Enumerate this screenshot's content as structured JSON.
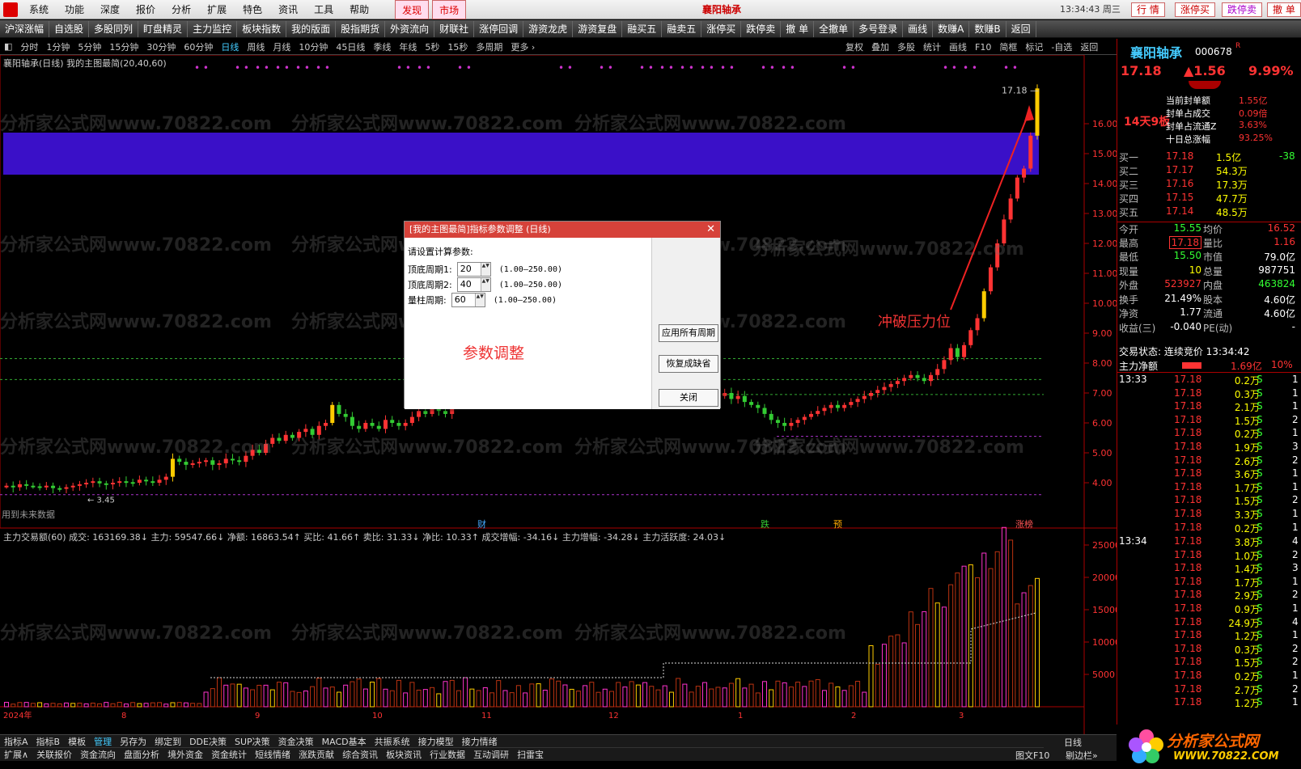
{
  "menu": {
    "items": [
      "系统",
      "功能",
      "深度",
      "报价",
      "分析",
      "扩展",
      "特色",
      "资讯",
      "工具",
      "帮助"
    ],
    "hot": [
      "发现",
      "市场"
    ],
    "title": "襄阳轴承",
    "time": "13:34:43 周三",
    "right_buttons": [
      "行 情",
      "涨停买",
      "跌停卖",
      "撤 单"
    ]
  },
  "toolbar": [
    "沪深涨幅",
    "自选股",
    "多股同列",
    "盯盘精灵",
    "主力监控",
    "板块指数",
    "我的版面",
    "股指期货",
    "外资流向",
    "财联社",
    "涨停回调",
    "游资龙虎",
    "游资复盘",
    "融买五",
    "融卖五",
    "涨停买",
    "跌停卖",
    "撤 单",
    "全撤单",
    "多号登录",
    "画线",
    "数赚A",
    "数赚B",
    "返回"
  ],
  "periods": [
    "分时",
    "1分钟",
    "5分钟",
    "15分钟",
    "30分钟",
    "60分钟",
    "日线",
    "周线",
    "月线",
    "10分钟",
    "45日线",
    "季线",
    "年线",
    "5秒",
    "15秒",
    "多周期",
    "更多 ›"
  ],
  "active_period": "日线",
  "toolright": [
    "复权",
    "叠加",
    "多股",
    "统计",
    "画线",
    "F10",
    "简框",
    "标记",
    "-自选",
    "返回"
  ],
  "chart_title": "襄阳轴承(日线)  我的主图最简(20,40,60)",
  "watermark": "分析家公式网www.70822.com",
  "price_labels": {
    "high": "17.18",
    "low": "3.45"
  },
  "future_note": "用到未来数据",
  "bottom_markers": [
    "财",
    "跌",
    "预",
    "涨榜"
  ],
  "annotation": "冲破压力位",
  "sub_title": "主力交易额(60) 成交: 163169.38↓ 主力: 59547.66↓ 净额: 16863.54↑ 买比: 41.66↑ 卖比: 31.33↓ 净比: 10.33↑ 成交增幅: -34.16↓ 主力增幅: -34.28↓ 主力活跃度: 24.03↓",
  "x_labels": [
    "2024年",
    "8",
    "9",
    "10",
    "11",
    "12",
    "1",
    "2",
    "3"
  ],
  "y_main": [
    "16.00",
    "15.00",
    "14.00",
    "13.00",
    "12.00",
    "11.00",
    "10.00",
    "9.00",
    "8.00",
    "7.00",
    "6.00",
    "5.00",
    "4.00"
  ],
  "y_sub": [
    "25000",
    "20000",
    "15000",
    "10000",
    "5000"
  ],
  "dialog": {
    "title": "[我的主图最简]指标参数调整 (日线)",
    "heading": "请设置计算参数:",
    "rows": [
      {
        "label": "顶底周期1:",
        "value": "20",
        "range": "(1.00—250.00)"
      },
      {
        "label": "顶底周期2:",
        "value": "40",
        "range": "(1.00—250.00)"
      },
      {
        "label": "量柱周期:",
        "value": "60",
        "range": "(1.00—250.00)"
      }
    ],
    "note": "参数调整",
    "buttons": [
      "应用所有周期",
      "恢复成缺省",
      "关闭"
    ]
  },
  "stock": {
    "name": "襄阳轴承",
    "code": "000678",
    "tag": "R",
    "price": "17.18",
    "change": "▲1.56",
    "pct": "9.99%",
    "board": "14天9板",
    "seal": [
      {
        "k": "当前封单额",
        "v": "1.55亿"
      },
      {
        "k": "封单占成交",
        "v": "0.09倍"
      },
      {
        "k": "封单占流通Z",
        "v": "3.63%"
      },
      {
        "k": "十日总涨幅",
        "v": "93.25%"
      }
    ],
    "buy": [
      {
        "k": "买一",
        "p": "17.18",
        "v": "1.5亿",
        "c": "-38"
      },
      {
        "k": "买二",
        "p": "17.17",
        "v": "54.3万",
        "c": ""
      },
      {
        "k": "买三",
        "p": "17.16",
        "v": "17.3万",
        "c": ""
      },
      {
        "k": "买四",
        "p": "17.15",
        "v": "47.7万",
        "c": ""
      },
      {
        "k": "买五",
        "p": "17.14",
        "v": "48.5万",
        "c": ""
      }
    ],
    "info": [
      {
        "k1": "今开",
        "v1": "15.55",
        "k2": "均价",
        "v2": "16.52"
      },
      {
        "k1": "最高",
        "v1": "17.18",
        "k2": "量比",
        "v2": "1.16"
      },
      {
        "k1": "最低",
        "v1": "15.50",
        "k2": "市值",
        "v2": "79.0亿"
      },
      {
        "k1": "现量",
        "v1": "10",
        "k2": "总量",
        "v2": "987751"
      },
      {
        "k1": "外盘",
        "v1": "523927",
        "k2": "内盘",
        "v2": "463824"
      },
      {
        "k1": "换手",
        "v1": "21.49%",
        "k2": "股本",
        "v2": "4.60亿"
      },
      {
        "k1": "净资",
        "v1": "1.77",
        "k2": "流通",
        "v2": "4.60亿"
      },
      {
        "k1": "收益(三)",
        "v1": "-0.040",
        "k2": "PE(动)",
        "v2": "-"
      }
    ],
    "state": "交易状态: 连续竞价 13:34:42",
    "flow_label": "主力净额",
    "flow_value": "1.69亿",
    "flow_pct": "10%",
    "ticks_1333": [
      [
        "17.18",
        "0.2万",
        "S",
        "1"
      ],
      [
        "17.18",
        "0.3万",
        "S",
        "1"
      ],
      [
        "17.18",
        "2.1万",
        "S",
        "1"
      ],
      [
        "17.18",
        "1.5万",
        "S",
        "2"
      ],
      [
        "17.18",
        "0.2万",
        "S",
        "1"
      ],
      [
        "17.18",
        "1.9万",
        "S",
        "3"
      ],
      [
        "17.18",
        "2.6万",
        "S",
        "2"
      ],
      [
        "17.18",
        "3.6万",
        "S",
        "1"
      ],
      [
        "17.18",
        "1.7万",
        "S",
        "1"
      ],
      [
        "17.18",
        "1.5万",
        "S",
        "2"
      ],
      [
        "17.18",
        "3.3万",
        "S",
        "1"
      ],
      [
        "17.18",
        "0.2万",
        "S",
        "1"
      ]
    ],
    "ticks_1334": [
      [
        "17.18",
        "3.8万",
        "S",
        "4"
      ],
      [
        "17.18",
        "1.0万",
        "S",
        "2"
      ],
      [
        "17.18",
        "1.4万",
        "S",
        "3"
      ],
      [
        "17.18",
        "1.7万",
        "S",
        "1"
      ],
      [
        "17.18",
        "2.9万",
        "S",
        "2"
      ],
      [
        "17.18",
        "0.9万",
        "S",
        "1"
      ],
      [
        "17.18",
        "24.9万",
        "S",
        "4"
      ],
      [
        "17.18",
        "1.2万",
        "S",
        "1"
      ],
      [
        "17.18",
        "0.3万",
        "S",
        "2"
      ],
      [
        "17.18",
        "1.5万",
        "S",
        "2"
      ],
      [
        "17.18",
        "0.2万",
        "S",
        "1"
      ],
      [
        "17.18",
        "2.7万",
        "S",
        "2"
      ],
      [
        "17.18",
        "1.2万",
        "S",
        "1"
      ]
    ]
  },
  "bottom1": [
    "指标A",
    "指标B",
    "模板",
    "管理",
    "另存为",
    "绑定到",
    "DDE决策",
    "SUP决策",
    "资金决策",
    "MACD基本",
    "共振系统",
    "接力模型",
    "接力情绪"
  ],
  "bottom2": [
    "扩展∧",
    "关联报价",
    "资金流向",
    "盘面分析",
    "境外资金",
    "资金统计",
    "短线情绪",
    "涨跌贡献",
    "综合资讯",
    "板块资讯",
    "行业数据",
    "互动调研",
    "扫雷宝"
  ],
  "bottom_right": [
    "日线",
    "图文F10",
    "剔边栏»"
  ],
  "brand": {
    "name": "分析家公式网",
    "url": "WWW.70822.COM"
  },
  "colors": {
    "up": "#ff3333",
    "down": "#33cc33",
    "limit": "#ffcc00",
    "band": "#3a10c8",
    "pink": "#ff33cc"
  }
}
